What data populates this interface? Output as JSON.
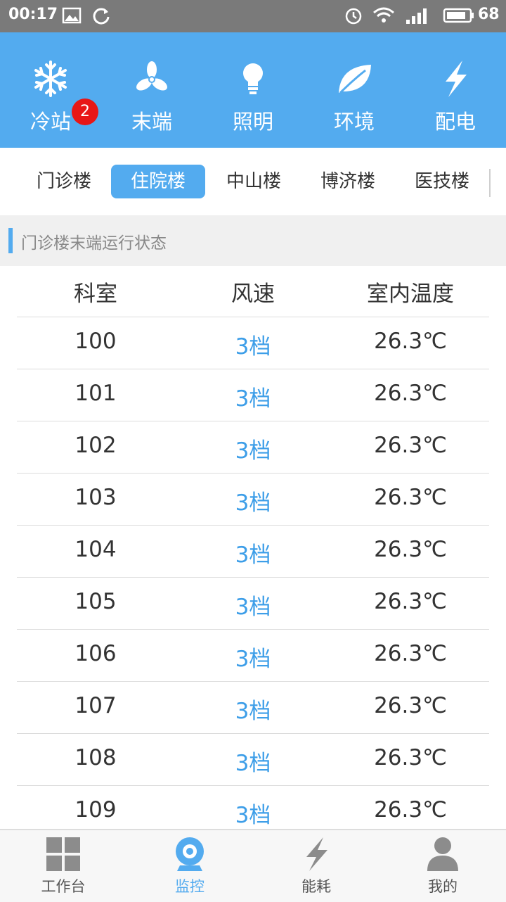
{
  "status_bar": {
    "time": "00:17",
    "battery": "68",
    "icons": [
      "image-icon",
      "sync-icon",
      "alarm-icon",
      "wifi-icon",
      "signal-4g-icon",
      "battery-icon"
    ]
  },
  "top_nav": {
    "items": [
      {
        "label": "冷站",
        "icon": "snowflake-icon",
        "badge": "2"
      },
      {
        "label": "末端",
        "icon": "fan-icon",
        "active": true
      },
      {
        "label": "照明",
        "icon": "lightbulb-icon"
      },
      {
        "label": "环境",
        "icon": "leaf-icon"
      },
      {
        "label": "配电",
        "icon": "lightning-icon"
      }
    ]
  },
  "buildings": {
    "items": [
      "门诊楼",
      "住院楼",
      "中山楼",
      "博济楼",
      "医技楼"
    ],
    "selected": "住院楼"
  },
  "section": {
    "title": "门诊楼末端运行状态"
  },
  "table": {
    "headers": [
      "科室",
      "风速",
      "室内温度"
    ],
    "rows": [
      {
        "room": "100",
        "speed": "3档",
        "temp": "26.3℃"
      },
      {
        "room": "101",
        "speed": "3档",
        "temp": "26.3℃"
      },
      {
        "room": "102",
        "speed": "3档",
        "temp": "26.3℃"
      },
      {
        "room": "103",
        "speed": "3档",
        "temp": "26.3℃"
      },
      {
        "room": "104",
        "speed": "3档",
        "temp": "26.3℃"
      },
      {
        "room": "105",
        "speed": "3档",
        "temp": "26.3℃"
      },
      {
        "room": "106",
        "speed": "3档",
        "temp": "26.3℃"
      },
      {
        "room": "107",
        "speed": "3档",
        "temp": "26.3℃"
      },
      {
        "room": "108",
        "speed": "3档",
        "temp": "26.3℃"
      },
      {
        "room": "109",
        "speed": "3档",
        "temp": "26.3℃"
      }
    ]
  },
  "bottom_nav": {
    "tabs": [
      {
        "label": "工作台",
        "icon": "grid-icon"
      },
      {
        "label": "监控",
        "icon": "camera-icon",
        "active": true
      },
      {
        "label": "能耗",
        "icon": "lightning-icon"
      },
      {
        "label": "我的",
        "icon": "person-icon"
      }
    ]
  },
  "colors": {
    "accent": "#53abef",
    "status_bar": "#7a7a7a",
    "badge": "#e81616",
    "speed_text": "#3d9ee8"
  }
}
